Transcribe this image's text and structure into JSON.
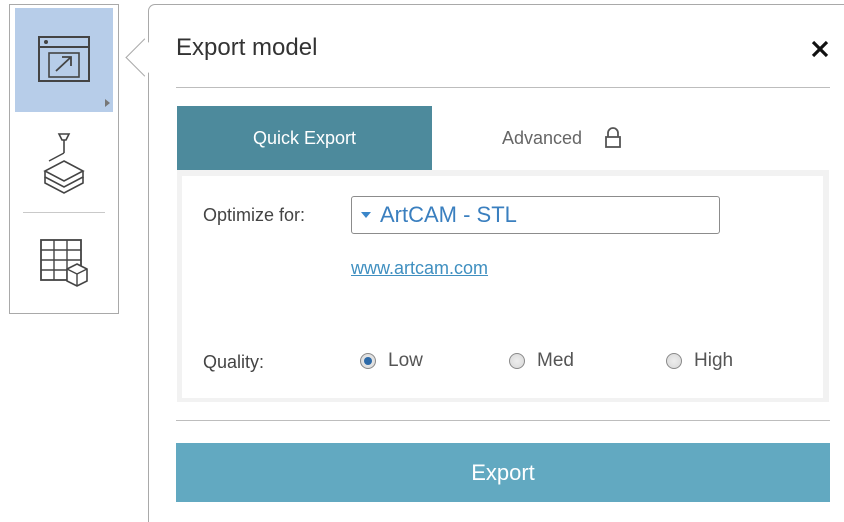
{
  "panel": {
    "title": "Export model",
    "close_label": "✕"
  },
  "toolbar": {
    "tools": [
      {
        "name": "export-icon",
        "active": true
      },
      {
        "name": "print-3d-icon",
        "active": false
      },
      {
        "name": "layout-grid-icon",
        "active": false
      }
    ]
  },
  "tabs": [
    {
      "label": "Quick Export",
      "active": true
    },
    {
      "label": "Advanced",
      "active": false,
      "locked": true
    }
  ],
  "form": {
    "optimize_label": "Optimize for:",
    "optimize_value": "ArtCAM - STL",
    "link_text": "www.artcam.com",
    "quality_label": "Quality:",
    "quality_options": [
      {
        "label": "Low",
        "selected": true
      },
      {
        "label": "Med",
        "selected": false
      },
      {
        "label": "High",
        "selected": false
      }
    ]
  },
  "export_button": "Export",
  "colors": {
    "active_tab": "#4d8a9c",
    "export_button": "#62a9c1",
    "active_tool": "#b7cde9",
    "link": "#3f8fc0"
  }
}
